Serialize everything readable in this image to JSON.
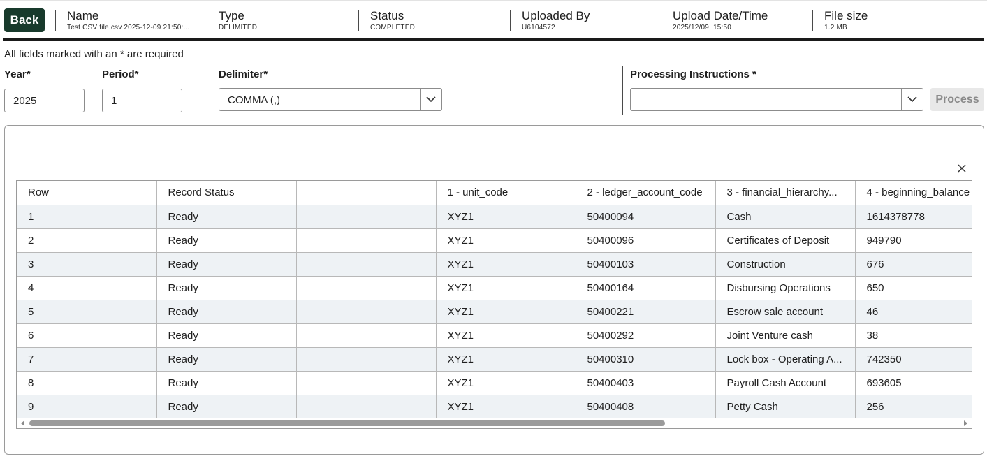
{
  "header": {
    "back_label": "Back",
    "name_label": "Name",
    "name_value": "Test CSV file.csv 2025-12-09 21:50:...",
    "type_label": "Type",
    "type_value": "DELIMITED",
    "status_label": "Status",
    "status_value": "COMPLETED",
    "uploader_label": "Uploaded By",
    "uploader_value": "U6104572",
    "date_label": "Upload Date/Time",
    "date_value": "2025/12/09, 15:50",
    "size_label": "File size",
    "size_value": "1.2 MB"
  },
  "form": {
    "required_note": "All fields marked with an * are required",
    "year_label": "Year*",
    "year_value": "2025",
    "period_label": "Period*",
    "period_value": "1",
    "delimiter_label": "Delimiter*",
    "delimiter_value": "COMMA (,)",
    "instructions_label": "Processing Instructions *",
    "instructions_value": "",
    "process_label": "Process"
  },
  "table": {
    "columns": [
      "Row",
      "Record Status",
      "",
      "1 - unit_code",
      "2 - ledger_account_code",
      "3 - financial_hierarchy...",
      "4 - beginning_balance"
    ],
    "rows": [
      [
        "1",
        "Ready",
        "",
        "XYZ1",
        "50400094",
        "Cash",
        "1614378778"
      ],
      [
        "2",
        "Ready",
        "",
        "XYZ1",
        "50400096",
        "Certificates of Deposit",
        "949790"
      ],
      [
        "3",
        "Ready",
        "",
        "XYZ1",
        "50400103",
        "Construction",
        "676"
      ],
      [
        "4",
        "Ready",
        "",
        "XYZ1",
        "50400164",
        "Disbursing Operations",
        "650"
      ],
      [
        "5",
        "Ready",
        "",
        "XYZ1",
        "50400221",
        "Escrow sale account",
        "46"
      ],
      [
        "6",
        "Ready",
        "",
        "XYZ1",
        "50400292",
        "Joint Venture cash",
        "38"
      ],
      [
        "7",
        "Ready",
        "",
        "XYZ1",
        "50400310",
        "Lock box - Operating A...",
        "742350"
      ],
      [
        "8",
        "Ready",
        "",
        "XYZ1",
        "50400403",
        "Payroll Cash Account",
        "693605"
      ],
      [
        "9",
        "Ready",
        "",
        "XYZ1",
        "50400408",
        "Petty Cash",
        "256"
      ]
    ]
  },
  "colors": {
    "back_button": "#183a2c",
    "row_stripe": "#eef2f5",
    "process_disabled": "#e8e8e8"
  },
  "icons": {
    "delimiter_dropdown": "chevron-down-icon",
    "instructions_dropdown": "chevron-down-icon",
    "close": "close-icon",
    "scroll_left": "caret-left-icon",
    "scroll_right": "caret-right-icon"
  }
}
